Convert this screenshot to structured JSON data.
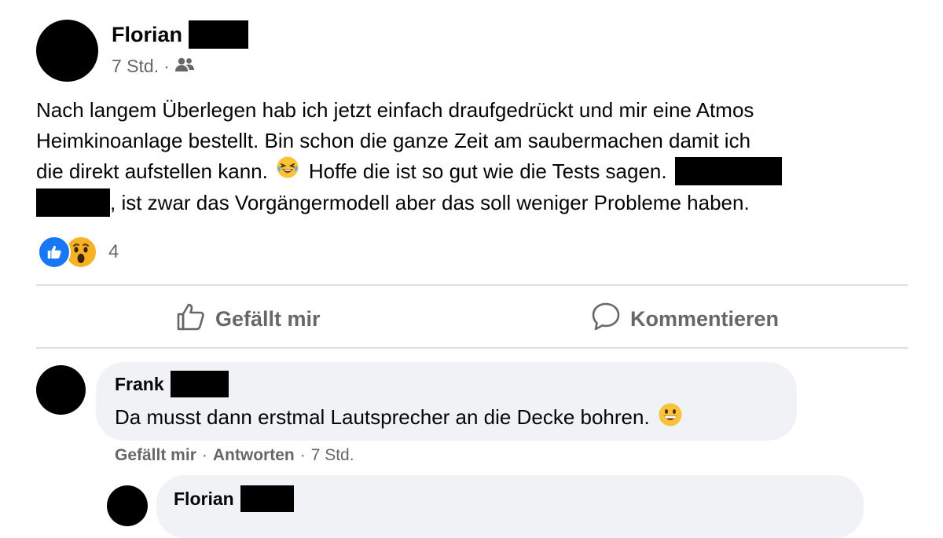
{
  "post": {
    "author": "Florian",
    "time": "7 Std.",
    "separator": "·",
    "audience_icon": "friends-icon",
    "text_lines": [
      "Nach langem Überlegen hab ich jetzt einfach draufgedrückt und mir eine Atmos",
      "Heimkinoanlage bestellt. Bin schon die ganze Zeit am saubermachen damit ich",
      "die direkt aufstellen kann.",
      "Hoffe die ist so gut wie die Tests sagen.",
      ", ist zwar das Vorgängermodell aber das soll weniger Probleme haben."
    ],
    "reactions": {
      "icons": [
        "like-reaction-icon",
        "wow-reaction-icon"
      ],
      "count": "4"
    }
  },
  "actions": {
    "like_label": "Gefällt mir",
    "comment_label": "Kommentieren"
  },
  "comments": [
    {
      "author": "Frank",
      "text": "Da musst dann erstmal Lautsprecher an die Decke bohren.",
      "like_label": "Gefällt mir",
      "reply_label": "Antworten",
      "time": "7 Std.",
      "separator": "·"
    },
    {
      "author": "Florian"
    }
  ],
  "colors": {
    "like_blue": "#1877f2",
    "wow_yellow": "#f7b125",
    "muted_text": "#65676b",
    "bubble_bg": "#f0f2f5",
    "divider": "#dadde1"
  }
}
